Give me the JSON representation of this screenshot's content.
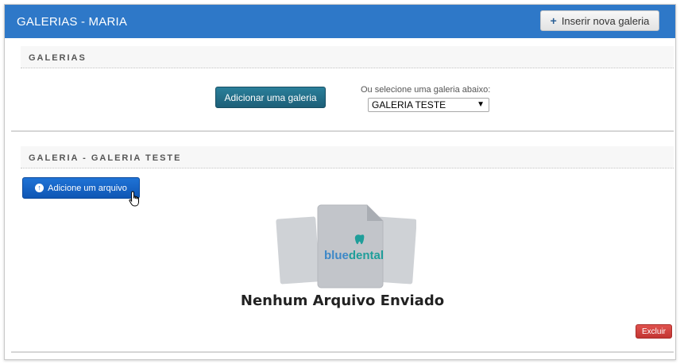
{
  "header": {
    "title": "GALERIAS - MARIA",
    "insert_button_label": "Inserir nova galeria",
    "insert_icon": "plus-icon"
  },
  "galleries_panel": {
    "heading": "GALERIAS",
    "add_button_label": "Adicionar uma galeria",
    "select_label": "Ou selecione uma galeria abaixo:",
    "selected_gallery": "GALERIA TESTE"
  },
  "gallery_panel": {
    "heading": "GALERIA - GALERIA TESTE",
    "upload_button_label": "Adicione um arquivo",
    "upload_icon": "upload-icon",
    "logo_text_blue": "blue",
    "logo_text_dental": "dental",
    "empty_message": "Nenhum Arquivo Enviado",
    "delete_button_label": "Excluir"
  },
  "colors": {
    "header_bg": "#2e78c8",
    "add_gallery_button": "#1d5f78",
    "upload_button": "#1565c9",
    "delete_button": "#c23532"
  }
}
